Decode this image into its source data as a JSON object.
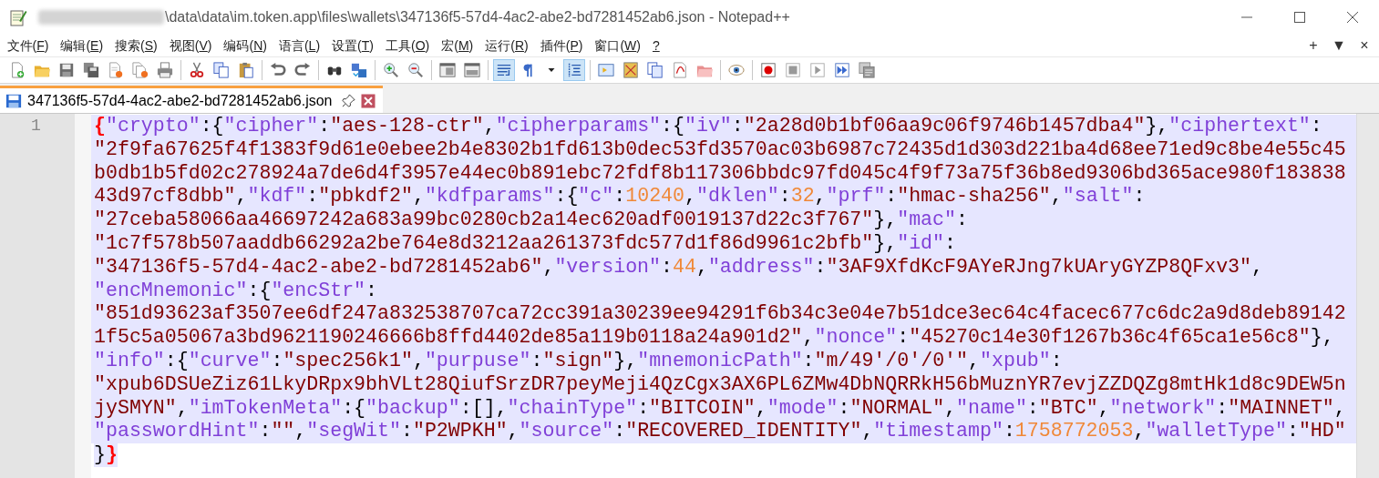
{
  "window": {
    "title": "\\data\\data\\im.token.app\\files\\wallets\\347136f5-57d4-4ac2-abe2-bd7281452ab6.json - Notepad++",
    "title_redacted": true
  },
  "menu": [
    "文件(F)",
    "编辑(E)",
    "搜索(S)",
    "视图(V)",
    "编码(N)",
    "语言(L)",
    "设置(T)",
    "工具(O)",
    "宏(M)",
    "运行(R)",
    "插件(P)",
    "窗口(W)",
    "?"
  ],
  "menu_right": [
    "+",
    "▼",
    "×"
  ],
  "toolbar": [
    {
      "kind": "button",
      "pressed": false
    },
    {
      "kind": "button",
      "pressed": false
    },
    {
      "kind": "button",
      "pressed": false
    },
    {
      "kind": "button",
      "pressed": false
    },
    {
      "kind": "button",
      "pressed": false
    },
    {
      "kind": "button",
      "pressed": false
    },
    {
      "kind": "button",
      "pressed": false
    },
    {
      "kind": "separator"
    },
    {
      "kind": "button",
      "pressed": false
    },
    {
      "kind": "button",
      "pressed": false
    },
    {
      "kind": "button",
      "pressed": false
    },
    {
      "kind": "separator"
    },
    {
      "kind": "button",
      "pressed": false
    },
    {
      "kind": "button",
      "pressed": false
    },
    {
      "kind": "separator"
    },
    {
      "kind": "button",
      "pressed": false
    },
    {
      "kind": "button",
      "pressed": false
    },
    {
      "kind": "separator"
    },
    {
      "kind": "button",
      "pressed": false
    },
    {
      "kind": "button",
      "pressed": false
    },
    {
      "kind": "separator"
    },
    {
      "kind": "button",
      "pressed": false
    },
    {
      "kind": "button",
      "pressed": false
    },
    {
      "kind": "separator"
    },
    {
      "kind": "button",
      "pressed": true
    },
    {
      "kind": "button",
      "pressed": false
    },
    {
      "kind": "dropdown",
      "pressed": false
    },
    {
      "kind": "button",
      "pressed": true
    },
    {
      "kind": "separator"
    },
    {
      "kind": "button",
      "pressed": false
    },
    {
      "kind": "button",
      "pressed": false
    },
    {
      "kind": "button",
      "pressed": false
    },
    {
      "kind": "button",
      "pressed": false
    },
    {
      "kind": "button",
      "pressed": false
    },
    {
      "kind": "separator"
    },
    {
      "kind": "button",
      "pressed": false
    },
    {
      "kind": "separator"
    },
    {
      "kind": "button",
      "pressed": false
    },
    {
      "kind": "button",
      "pressed": false
    },
    {
      "kind": "button",
      "pressed": false
    },
    {
      "kind": "button",
      "pressed": false
    },
    {
      "kind": "button",
      "pressed": false
    }
  ],
  "tabs": [
    {
      "label": "347136f5-57d4-4ac2-abe2-bd7281452ab6.json",
      "selected": true
    }
  ],
  "editor": {
    "line_number": "1",
    "text_selected": true,
    "lines": [
      [
        {
          "kind": "brace",
          "text": "{"
        },
        {
          "kind": "key",
          "text": "\"crypto\""
        },
        {
          "kind": "punct",
          "text": ":{"
        },
        {
          "kind": "key",
          "text": "\"cipher\""
        },
        {
          "kind": "punct",
          "text": ":"
        },
        {
          "kind": "string",
          "text": "\"aes-128-ctr\""
        },
        {
          "kind": "punct",
          "text": ","
        },
        {
          "kind": "key",
          "text": "\"cipherparams\""
        },
        {
          "kind": "punct",
          "text": ":{"
        },
        {
          "kind": "key",
          "text": "\"iv\""
        },
        {
          "kind": "punct",
          "text": ":"
        },
        {
          "kind": "string",
          "text": "\"2a28d0b1bf06aa9c06f9746b1457dba4\""
        },
        {
          "kind": "punct",
          "text": "},"
        },
        {
          "kind": "key",
          "text": "\"ciphertext\""
        },
        {
          "kind": "punct",
          "text": ":"
        }
      ],
      [
        {
          "kind": "string",
          "text": "\"2f9fa67625f4f1383f9d61e0ebee2b4e8302b1fd613b0dec53fd3570ac03b6987c72435d1d303d221ba4d68ee71ed9c8be4e55c45"
        }
      ],
      [
        {
          "kind": "string",
          "text": "b0db1b5fd02c278924a7de6d4f3957e44ec0b891ebc72fdf8b117306bbdc97fd045c4f9f73a75f36b8ed9306bd365ace980f183838"
        }
      ],
      [
        {
          "kind": "string",
          "text": "43d97cf8dbb\""
        },
        {
          "kind": "punct",
          "text": ","
        },
        {
          "kind": "key",
          "text": "\"kdf\""
        },
        {
          "kind": "punct",
          "text": ":"
        },
        {
          "kind": "string",
          "text": "\"pbkdf2\""
        },
        {
          "kind": "punct",
          "text": ","
        },
        {
          "kind": "key",
          "text": "\"kdfparams\""
        },
        {
          "kind": "punct",
          "text": ":{"
        },
        {
          "kind": "key",
          "text": "\"c\""
        },
        {
          "kind": "punct",
          "text": ":"
        },
        {
          "kind": "number",
          "text": "10240"
        },
        {
          "kind": "punct",
          "text": ","
        },
        {
          "kind": "key",
          "text": "\"dklen\""
        },
        {
          "kind": "punct",
          "text": ":"
        },
        {
          "kind": "number",
          "text": "32"
        },
        {
          "kind": "punct",
          "text": ","
        },
        {
          "kind": "key",
          "text": "\"prf\""
        },
        {
          "kind": "punct",
          "text": ":"
        },
        {
          "kind": "string",
          "text": "\"hmac-sha256\""
        },
        {
          "kind": "punct",
          "text": ","
        },
        {
          "kind": "key",
          "text": "\"salt\""
        },
        {
          "kind": "punct",
          "text": ":"
        }
      ],
      [
        {
          "kind": "string",
          "text": "\"27ceba58066aa46697242a683a99bc0280cb2a14ec620adf0019137d22c3f767\""
        },
        {
          "kind": "punct",
          "text": "},"
        },
        {
          "kind": "key",
          "text": "\"mac\""
        },
        {
          "kind": "punct",
          "text": ":"
        }
      ],
      [
        {
          "kind": "string",
          "text": "\"1c7f578b507aaddb66292a2be764e8d3212aa261373fdc577d1f86d9961c2bfb\""
        },
        {
          "kind": "punct",
          "text": "},"
        },
        {
          "kind": "key",
          "text": "\"id\""
        },
        {
          "kind": "punct",
          "text": ":"
        }
      ],
      [
        {
          "kind": "string",
          "text": "\"347136f5-57d4-4ac2-abe2-bd7281452ab6\""
        },
        {
          "kind": "punct",
          "text": ","
        },
        {
          "kind": "key",
          "text": "\"version\""
        },
        {
          "kind": "punct",
          "text": ":"
        },
        {
          "kind": "number",
          "text": "44"
        },
        {
          "kind": "punct",
          "text": ","
        },
        {
          "kind": "key",
          "text": "\"address\""
        },
        {
          "kind": "punct",
          "text": ":"
        },
        {
          "kind": "string",
          "text": "\"3AF9XfdKcF9AYeRJng7kUAryGYZP8QFxv3\""
        },
        {
          "kind": "punct",
          "text": ","
        }
      ],
      [
        {
          "kind": "key",
          "text": "\"encMnemonic\""
        },
        {
          "kind": "punct",
          "text": ":{"
        },
        {
          "kind": "key",
          "text": "\"encStr\""
        },
        {
          "kind": "punct",
          "text": ":"
        }
      ],
      [
        {
          "kind": "string",
          "text": "\"851d93623af3507ee6df247a832538707ca72cc391a30239ee94291f6b34c3e04e7b51dce3ec64c4facec677c6dc2a9d8deb89142"
        }
      ],
      [
        {
          "kind": "string",
          "text": "1f5c5a05067a3bd9621190246666b8ffd4402de85a119b0118a24a901d2\""
        },
        {
          "kind": "punct",
          "text": ","
        },
        {
          "kind": "key",
          "text": "\"nonce\""
        },
        {
          "kind": "punct",
          "text": ":"
        },
        {
          "kind": "string",
          "text": "\"45270c14e30f1267b36c4f65ca1e56c8\""
        },
        {
          "kind": "punct",
          "text": "},"
        }
      ],
      [
        {
          "kind": "key",
          "text": "\"info\""
        },
        {
          "kind": "punct",
          "text": ":{"
        },
        {
          "kind": "key",
          "text": "\"curve\""
        },
        {
          "kind": "punct",
          "text": ":"
        },
        {
          "kind": "string",
          "text": "\"spec256k1\""
        },
        {
          "kind": "punct",
          "text": ","
        },
        {
          "kind": "key",
          "text": "\"purpuse\""
        },
        {
          "kind": "punct",
          "text": ":"
        },
        {
          "kind": "string",
          "text": "\"sign\""
        },
        {
          "kind": "punct",
          "text": "},"
        },
        {
          "kind": "key",
          "text": "\"mnemonicPath\""
        },
        {
          "kind": "punct",
          "text": ":"
        },
        {
          "kind": "string",
          "text": "\"m/49'/0'/0'\""
        },
        {
          "kind": "punct",
          "text": ","
        },
        {
          "kind": "key",
          "text": "\"xpub\""
        },
        {
          "kind": "punct",
          "text": ":"
        }
      ],
      [
        {
          "kind": "string",
          "text": "\"xpub6DSUeZiz61LkyDRpx9bhVLt28QiufSrzDR7peyMeji4QzCgx3AX6PL6ZMw4DbNQRRkH56bMuznYR7evjZZDQZg8mtHk1d8c9DEW5n"
        }
      ],
      [
        {
          "kind": "string",
          "text": "jySMYN\""
        },
        {
          "kind": "punct",
          "text": ","
        },
        {
          "kind": "key",
          "text": "\"imTokenMeta\""
        },
        {
          "kind": "punct",
          "text": ":{"
        },
        {
          "kind": "key",
          "text": "\"backup\""
        },
        {
          "kind": "punct",
          "text": ":[],"
        },
        {
          "kind": "key",
          "text": "\"chainType\""
        },
        {
          "kind": "punct",
          "text": ":"
        },
        {
          "kind": "string",
          "text": "\"BITCOIN\""
        },
        {
          "kind": "punct",
          "text": ","
        },
        {
          "kind": "key",
          "text": "\"mode\""
        },
        {
          "kind": "punct",
          "text": ":"
        },
        {
          "kind": "string",
          "text": "\"NORMAL\""
        },
        {
          "kind": "punct",
          "text": ","
        },
        {
          "kind": "key",
          "text": "\"name\""
        },
        {
          "kind": "punct",
          "text": ":"
        },
        {
          "kind": "string",
          "text": "\"BTC\""
        },
        {
          "kind": "punct",
          "text": ","
        },
        {
          "kind": "key",
          "text": "\"network\""
        },
        {
          "kind": "punct",
          "text": ":"
        },
        {
          "kind": "string",
          "text": "\"MAINNET\""
        },
        {
          "kind": "punct",
          "text": ","
        }
      ],
      [
        {
          "kind": "key",
          "text": "\"passwordHint\""
        },
        {
          "kind": "punct",
          "text": ":"
        },
        {
          "kind": "string",
          "text": "\"\""
        },
        {
          "kind": "punct",
          "text": ","
        },
        {
          "kind": "key",
          "text": "\"segWit\""
        },
        {
          "kind": "punct",
          "text": ":"
        },
        {
          "kind": "string",
          "text": "\"P2WPKH\""
        },
        {
          "kind": "punct",
          "text": ","
        },
        {
          "kind": "key",
          "text": "\"source\""
        },
        {
          "kind": "punct",
          "text": ":"
        },
        {
          "kind": "string",
          "text": "\"RECOVERED_IDENTITY\""
        },
        {
          "kind": "punct",
          "text": ","
        },
        {
          "kind": "key",
          "text": "\"timestamp\""
        },
        {
          "kind": "punct",
          "text": ":"
        },
        {
          "kind": "number",
          "text": "1758772053"
        },
        {
          "kind": "punct",
          "text": ","
        },
        {
          "kind": "key",
          "text": "\"walletType\""
        },
        {
          "kind": "punct",
          "text": ":"
        },
        {
          "kind": "string",
          "text": "\"HD\""
        }
      ],
      [
        {
          "kind": "punct",
          "text": "}"
        },
        {
          "kind": "brace",
          "text": "}"
        }
      ]
    ]
  }
}
